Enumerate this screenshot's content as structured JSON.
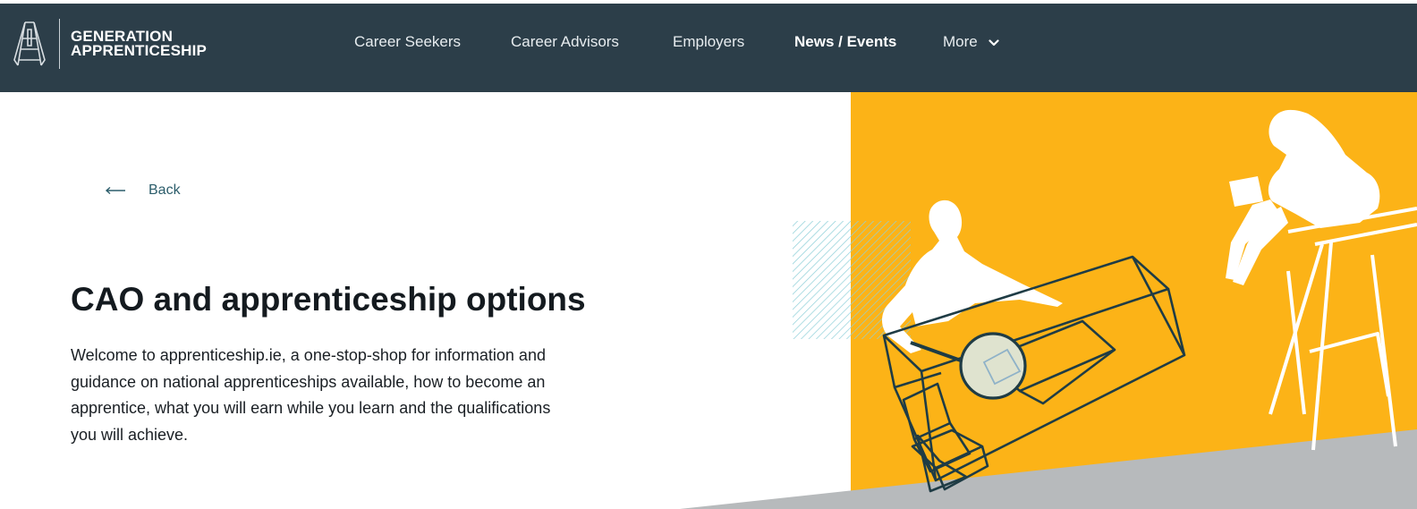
{
  "brand": {
    "line1": "GENERATION",
    "line2": "APPRENTICESHIP",
    "header_color": "#2c3e49"
  },
  "nav": {
    "items": [
      {
        "label": "Career Seekers"
      },
      {
        "label": "Career Advisors"
      },
      {
        "label": "Employers"
      },
      {
        "label": "News / Events",
        "active": true
      },
      {
        "label": "More"
      }
    ]
  },
  "back": {
    "label": "Back",
    "icon": "arrow-left-icon"
  },
  "page": {
    "title": "CAO and apprenticeship options",
    "intro": "Welcome to apprenticeship.ie, a one-stop-shop for information and guidance on national apprenticeships available, how to become an apprentice, what you will earn while you learn and the qualifications you will achieve."
  },
  "colors": {
    "accent_yellow": "#fcb317",
    "dark_teal": "#1f3c45",
    "light_teal_hatch": "#8fd0d8",
    "grey_band": "#b7babc",
    "lens_fill": "#dfe3cf"
  }
}
